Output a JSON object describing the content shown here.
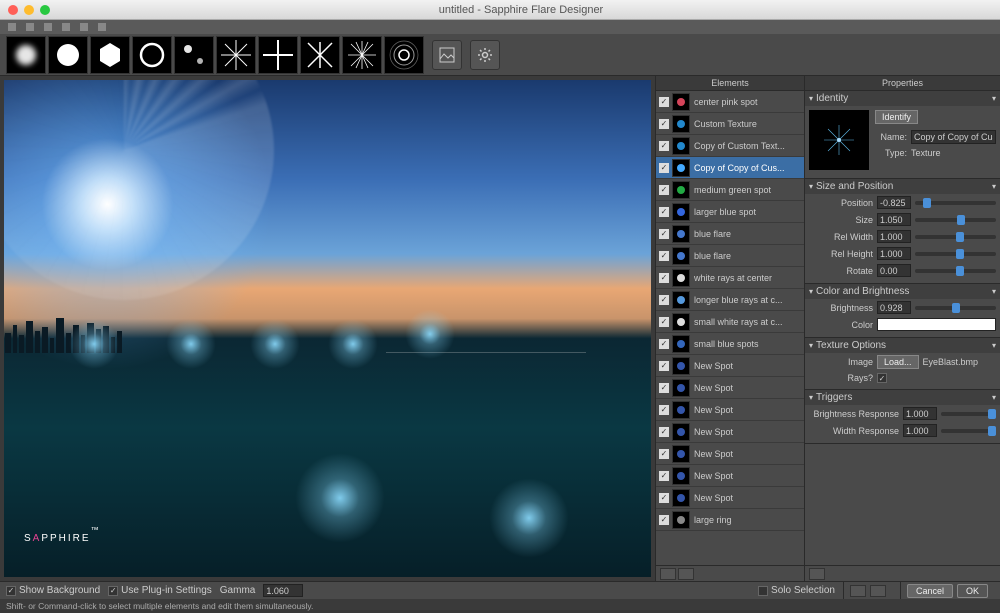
{
  "window_title": "untitled - Sapphire Flare Designer",
  "panels": {
    "elements_title": "Elements",
    "properties_title": "Properties"
  },
  "elements": [
    {
      "checked": true,
      "label": "center pink spot",
      "color": "#d4445a",
      "selected": false
    },
    {
      "checked": true,
      "label": "Custom Texture",
      "color": "#2288cc",
      "selected": false
    },
    {
      "checked": true,
      "label": "Copy of Custom Text...",
      "color": "#2288cc",
      "selected": false
    },
    {
      "checked": true,
      "label": "Copy of Copy of Cus...",
      "color": "#44aaff",
      "selected": true
    },
    {
      "checked": true,
      "label": "medium green spot",
      "color": "#22aa44",
      "selected": false
    },
    {
      "checked": true,
      "label": "larger blue spot",
      "color": "#3366dd",
      "selected": false
    },
    {
      "checked": true,
      "label": "blue flare",
      "color": "#4477cc",
      "selected": false
    },
    {
      "checked": true,
      "label": "blue flare",
      "color": "#4477cc",
      "selected": false
    },
    {
      "checked": true,
      "label": "white rays at center",
      "color": "#dddddd",
      "selected": false
    },
    {
      "checked": true,
      "label": "longer blue rays at c...",
      "color": "#5599dd",
      "selected": false
    },
    {
      "checked": true,
      "label": "small white rays at c...",
      "color": "#dddddd",
      "selected": false
    },
    {
      "checked": true,
      "label": "small blue spots",
      "color": "#3366bb",
      "selected": false
    },
    {
      "checked": true,
      "label": "New Spot",
      "color": "#3355aa",
      "selected": false
    },
    {
      "checked": true,
      "label": "New Spot",
      "color": "#3355aa",
      "selected": false
    },
    {
      "checked": true,
      "label": "New Spot",
      "color": "#3355aa",
      "selected": false
    },
    {
      "checked": true,
      "label": "New Spot",
      "color": "#3355aa",
      "selected": false
    },
    {
      "checked": true,
      "label": "New Spot",
      "color": "#3355aa",
      "selected": false
    },
    {
      "checked": true,
      "label": "New Spot",
      "color": "#3355aa",
      "selected": false
    },
    {
      "checked": true,
      "label": "New Spot",
      "color": "#3355aa",
      "selected": false
    },
    {
      "checked": true,
      "label": "large ring",
      "color": "#888888",
      "selected": false
    }
  ],
  "properties": {
    "identity": {
      "section": "Identity",
      "identify_btn": "Identify",
      "name_label": "Name:",
      "name_value": "Copy of Copy of Custom Te",
      "type_label": "Type:",
      "type_value": "Texture"
    },
    "size_position": {
      "section": "Size and Position",
      "position_label": "Position",
      "position_value": "-0.825",
      "size_label": "Size",
      "size_value": "1.050",
      "rel_width_label": "Rel Width",
      "rel_width_value": "1.000",
      "rel_height_label": "Rel Height",
      "rel_height_value": "1.000",
      "rotate_label": "Rotate",
      "rotate_value": "0.00"
    },
    "color_brightness": {
      "section": "Color and Brightness",
      "brightness_label": "Brightness",
      "brightness_value": "0.928",
      "color_label": "Color"
    },
    "texture": {
      "section": "Texture Options",
      "image_label": "Image",
      "load_btn": "Load...",
      "filename": "EyeBlast.bmp",
      "rays_label": "Rays?"
    },
    "triggers": {
      "section": "Triggers",
      "brightness_resp_label": "Brightness Response",
      "brightness_resp_value": "1.000",
      "width_resp_label": "Width Response",
      "width_resp_value": "1.000"
    }
  },
  "footer": {
    "show_bg": "Show Background",
    "use_plugin": "Use Plug-in Settings",
    "gamma_label": "Gamma",
    "gamma_value": "1.060",
    "solo": "Solo Selection",
    "cancel": "Cancel",
    "ok": "OK"
  },
  "status_text": "Shift- or Command-click to select multiple elements and edit them simultaneously.",
  "logo": {
    "pre": "S",
    "accent": "A",
    "post": "PPHIRE",
    "tm": "™"
  }
}
